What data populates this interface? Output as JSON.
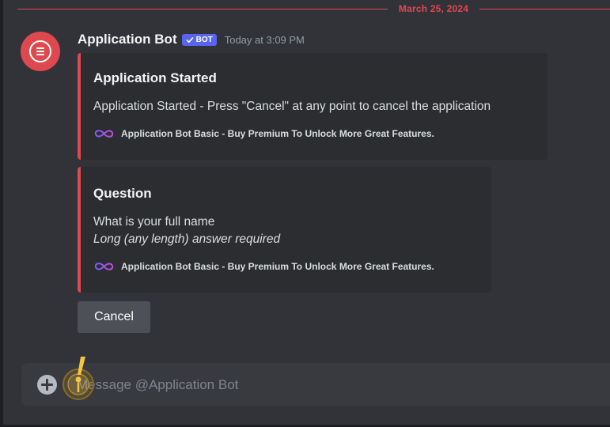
{
  "divider": {
    "date": "March 25, 2024"
  },
  "message": {
    "author": "Application Bot",
    "bot_tag": "BOT",
    "timestamp": "Today at 3:09 PM",
    "avatar_icon": "list-icon"
  },
  "embeds": [
    {
      "title": "Application Started",
      "description": "Application Started - Press \"Cancel\" at any point to cancel the application",
      "footer": "Application Bot Basic - Buy Premium To Unlock More Great Features.",
      "footer_icon": "infinity-icon"
    },
    {
      "title": "Question",
      "description": "What is your full name",
      "description_italic": "Long (any length) answer required",
      "footer": "Application Bot Basic - Buy Premium To Unlock More Great Features.",
      "footer_icon": "infinity-icon"
    }
  ],
  "buttons": {
    "cancel": "Cancel"
  },
  "composer": {
    "placeholder": "Message @Application Bot"
  },
  "colors": {
    "background": "#313338",
    "embed_background": "#2b2d31",
    "accent_red": "#e0484f",
    "bot_tag": "#5865f2",
    "cancel_button": "#4e5058",
    "composer": "#383a40",
    "cursor_highlight": "#f5c542"
  }
}
